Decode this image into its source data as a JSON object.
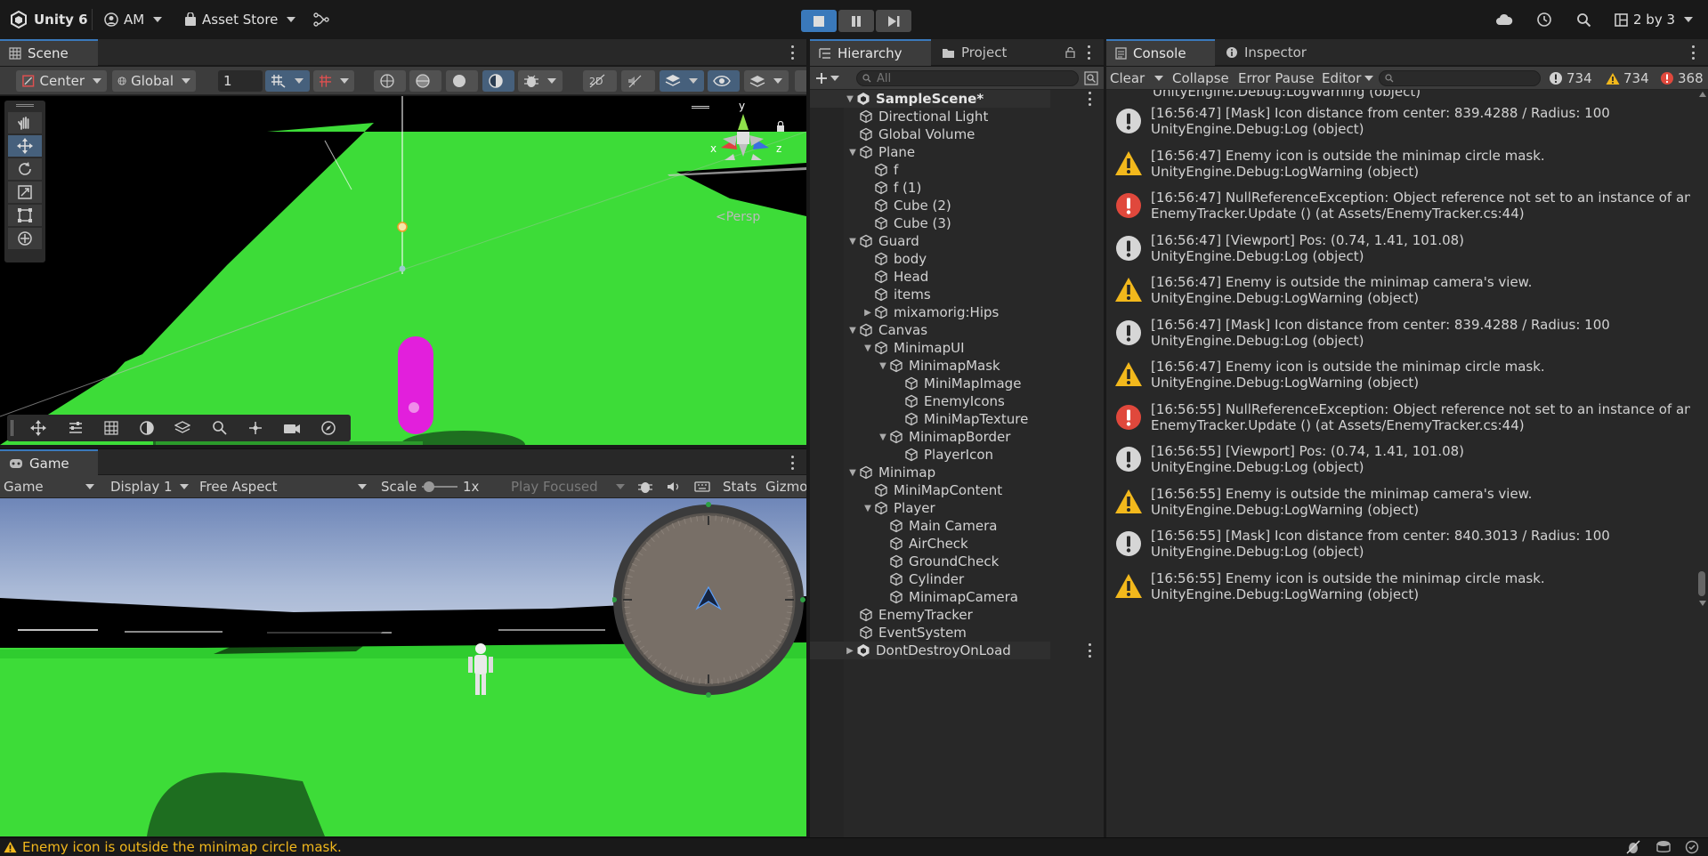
{
  "topbar": {
    "logo_label": "Unity 6",
    "account": "AM",
    "asset_store": "Asset Store",
    "layout": "2 by 3"
  },
  "scene": {
    "tab": "Scene",
    "pivot": "Center",
    "space": "Global",
    "snap_value": "1",
    "persp_label": "<Persp",
    "axis_y": "y",
    "axis_x": "x",
    "axis_z": "z"
  },
  "game": {
    "tab": "Game",
    "mode": "Game",
    "display": "Display 1",
    "aspect": "Free Aspect",
    "scale_label": "Scale",
    "scale_value": "1x",
    "play_focused": "Play Focused",
    "stats": "Stats",
    "gizmos": "Gizmo"
  },
  "hierarchy": {
    "tab": "Hierarchy",
    "project_tab": "Project",
    "search_placeholder": "All",
    "items": [
      {
        "label": "SampleScene*",
        "depth": 0,
        "arrow": "down",
        "scene": true
      },
      {
        "label": "Directional Light",
        "depth": 1,
        "arrow": ""
      },
      {
        "label": "Global Volume",
        "depth": 1,
        "arrow": ""
      },
      {
        "label": "Plane",
        "depth": 1,
        "arrow": "down"
      },
      {
        "label": "f",
        "depth": 2,
        "arrow": ""
      },
      {
        "label": "f (1)",
        "depth": 2,
        "arrow": ""
      },
      {
        "label": "Cube (2)",
        "depth": 2,
        "arrow": ""
      },
      {
        "label": "Cube (3)",
        "depth": 2,
        "arrow": ""
      },
      {
        "label": "Guard",
        "depth": 1,
        "arrow": "down"
      },
      {
        "label": "body",
        "depth": 2,
        "arrow": ""
      },
      {
        "label": "Head",
        "depth": 2,
        "arrow": ""
      },
      {
        "label": "items",
        "depth": 2,
        "arrow": ""
      },
      {
        "label": "mixamorig:Hips",
        "depth": 2,
        "arrow": "right"
      },
      {
        "label": "Canvas",
        "depth": 1,
        "arrow": "down"
      },
      {
        "label": "MinimapUI",
        "depth": 2,
        "arrow": "down"
      },
      {
        "label": "MinimapMask",
        "depth": 3,
        "arrow": "down"
      },
      {
        "label": "MiniMapImage",
        "depth": 4,
        "arrow": ""
      },
      {
        "label": "EnemyIcons",
        "depth": 4,
        "arrow": ""
      },
      {
        "label": "MiniMapTexture",
        "depth": 4,
        "arrow": ""
      },
      {
        "label": "MinimapBorder",
        "depth": 3,
        "arrow": "down"
      },
      {
        "label": "PlayerIcon",
        "depth": 4,
        "arrow": ""
      },
      {
        "label": "Minimap",
        "depth": 1,
        "arrow": "down"
      },
      {
        "label": "MiniMapContent",
        "depth": 2,
        "arrow": ""
      },
      {
        "label": "Player",
        "depth": 2,
        "arrow": "down"
      },
      {
        "label": "Main Camera",
        "depth": 3,
        "arrow": ""
      },
      {
        "label": "AirCheck",
        "depth": 3,
        "arrow": ""
      },
      {
        "label": "GroundCheck",
        "depth": 3,
        "arrow": ""
      },
      {
        "label": "Cylinder",
        "depth": 3,
        "arrow": ""
      },
      {
        "label": "MinimapCamera",
        "depth": 3,
        "arrow": ""
      },
      {
        "label": "EnemyTracker",
        "depth": 1,
        "arrow": ""
      },
      {
        "label": "EventSystem",
        "depth": 1,
        "arrow": ""
      },
      {
        "label": "DontDestroyOnLoad",
        "depth": 0,
        "arrow": "right",
        "scene": true
      }
    ]
  },
  "console": {
    "tab": "Console",
    "inspector_tab": "Inspector",
    "clear": "Clear",
    "collapse": "Collapse",
    "error_pause": "Error Pause",
    "editor": "Editor",
    "count_log": "734",
    "count_warn": "734",
    "count_error": "368",
    "partial_top": "UnityEngine.Debug:LogWarning (object)",
    "entries": [
      {
        "type": "log",
        "line1": "[16:56:47] [Mask] Icon distance from center: 839.4288 / Radius: 100",
        "line2": "UnityEngine.Debug:Log (object)"
      },
      {
        "type": "warn",
        "line1": "[16:56:47] Enemy icon is outside the minimap circle mask.",
        "line2": "UnityEngine.Debug:LogWarning (object)"
      },
      {
        "type": "error",
        "line1": "[16:56:47] NullReferenceException: Object reference not set to an instance of an object",
        "line2": "EnemyTracker.Update () (at Assets/EnemyTracker.cs:44)"
      },
      {
        "type": "log",
        "line1": "[16:56:47] [Viewport] Pos: (0.74, 1.41, 101.08)",
        "line2": "UnityEngine.Debug:Log (object)"
      },
      {
        "type": "warn",
        "line1": "[16:56:47] Enemy is outside the minimap camera's view.",
        "line2": "UnityEngine.Debug:LogWarning (object)"
      },
      {
        "type": "log",
        "line1": "[16:56:47] [Mask] Icon distance from center: 839.4288 / Radius: 100",
        "line2": "UnityEngine.Debug:Log (object)"
      },
      {
        "type": "warn",
        "line1": "[16:56:47] Enemy icon is outside the minimap circle mask.",
        "line2": "UnityEngine.Debug:LogWarning (object)"
      },
      {
        "type": "error",
        "line1": "[16:56:55] NullReferenceException: Object reference not set to an instance of an object",
        "line2": "EnemyTracker.Update () (at Assets/EnemyTracker.cs:44)"
      },
      {
        "type": "log",
        "line1": "[16:56:55] [Viewport] Pos: (0.74, 1.41, 101.08)",
        "line2": "UnityEngine.Debug:Log (object)"
      },
      {
        "type": "warn",
        "line1": "[16:56:55] Enemy is outside the minimap camera's view.",
        "line2": "UnityEngine.Debug:LogWarning (object)"
      },
      {
        "type": "log",
        "line1": "[16:56:55] [Mask] Icon distance from center: 840.3013 / Radius: 100",
        "line2": "UnityEngine.Debug:Log (object)"
      },
      {
        "type": "warn",
        "line1": "[16:56:55] Enemy icon is outside the minimap circle mask.",
        "line2": "UnityEngine.Debug:LogWarning (object)"
      }
    ]
  },
  "statusbar": {
    "message": "Enemy icon is outside the minimap circle mask."
  },
  "colors": {
    "accent": "#3a79bb",
    "warning": "#f2b81c",
    "error": "#e0483c",
    "ground": "#3ddc38",
    "capsule": "#e21fdc"
  }
}
